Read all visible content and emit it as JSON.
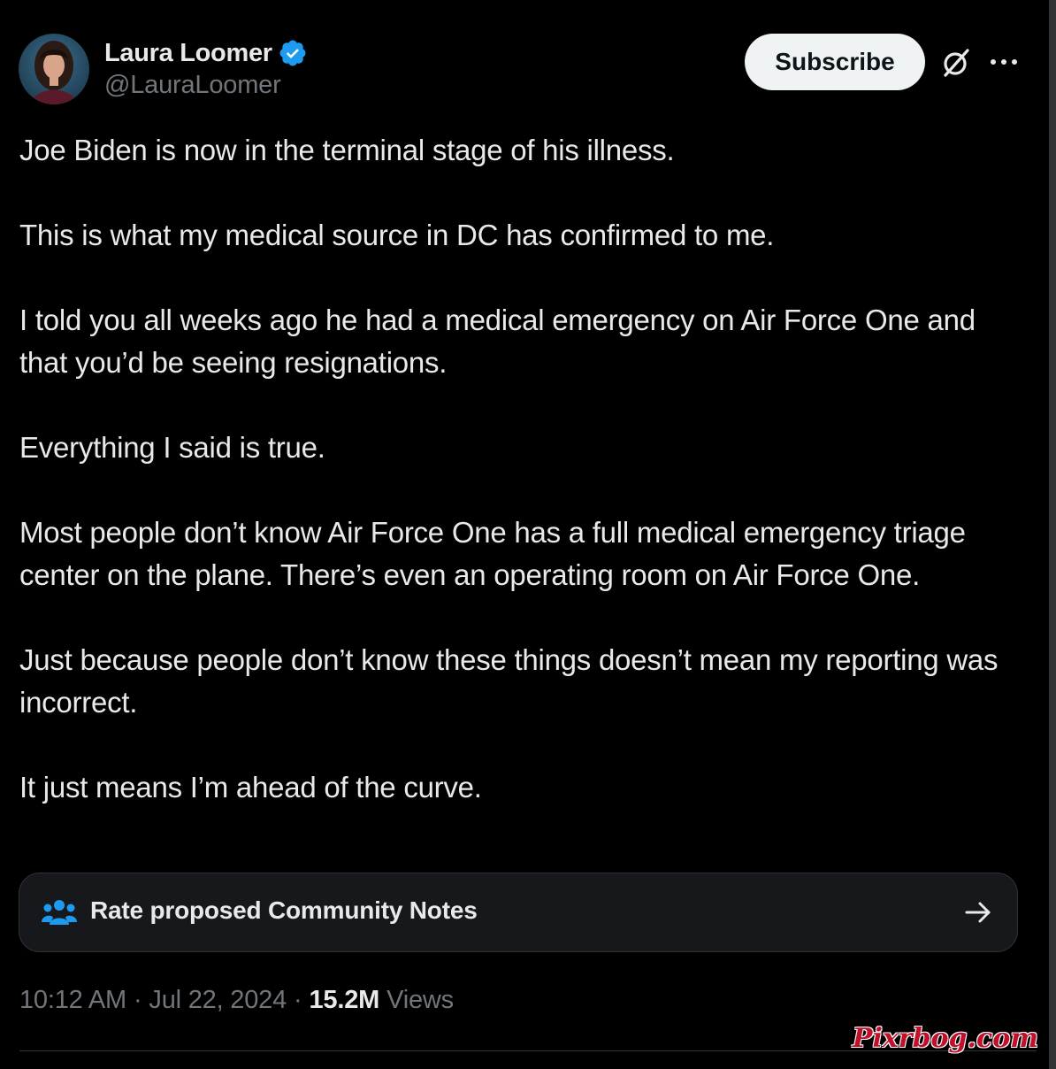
{
  "author": {
    "display_name": "Laura Loomer",
    "handle": "@LauraLoomer",
    "verified": true
  },
  "header": {
    "subscribe_label": "Subscribe"
  },
  "tweet": {
    "paragraphs": [
      "Joe Biden is now in the terminal stage of his illness.",
      "This is what my medical source in DC has confirmed to me.",
      "I told you all weeks ago he had a medical emergency on Air Force One and that you’d be seeing resignations.",
      "Everything I said is true.",
      "Most people don’t know Air Force One has a full medical emergency triage center on the plane. There’s even an operating room on Air Force One.",
      "Just because people don’t know these things doesn’t mean my reporting was incorrect.",
      "It just means I’m ahead of the curve."
    ]
  },
  "community_notes": {
    "label": "Rate proposed Community Notes"
  },
  "meta": {
    "time": "10:12 AM",
    "date": "Jul 22, 2024",
    "separator": "·",
    "views_count": "15.2M",
    "views_label": "Views"
  },
  "watermark": "Pixrbog.com",
  "colors": {
    "background": "#000000",
    "text_primary": "#e7e9ea",
    "text_secondary": "#71767b",
    "verified_blue": "#1d9bf0",
    "community_notes_icon": "#1d9bf0",
    "card_background": "#16181c",
    "border": "#2f3336",
    "watermark": "#c0102a"
  },
  "icons": {
    "verified": "verified-badge-icon",
    "grok": "grok-icon",
    "more": "more-icon",
    "community_notes": "people-icon",
    "arrow": "arrow-right-icon"
  }
}
